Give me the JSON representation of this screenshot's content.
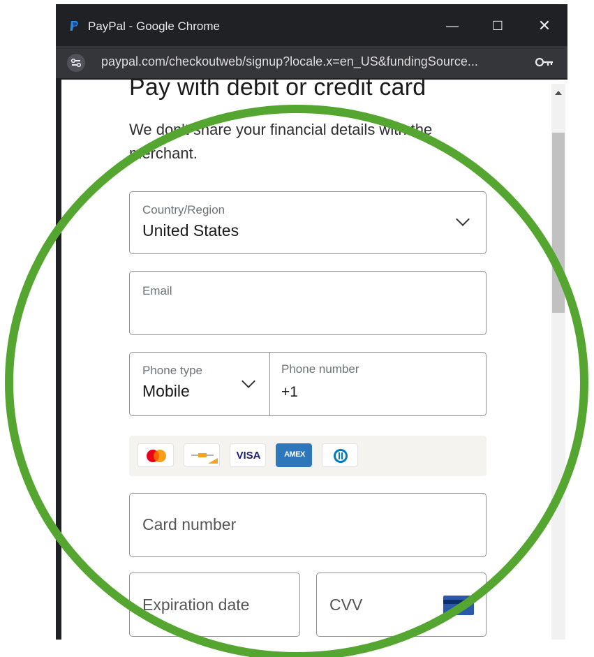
{
  "window": {
    "title": "PayPal - Google Chrome",
    "minimize_glyph": "—",
    "maximize_glyph": "☐",
    "close_glyph": "✕",
    "url": "paypal.com/checkoutweb/signup?locale.x=en_US&fundingSource..."
  },
  "page": {
    "heading": "Pay with debit or credit card",
    "subtitle": "We don't share your financial details with the merchant."
  },
  "form": {
    "country": {
      "label": "Country/Region",
      "value": "United States"
    },
    "email": {
      "label": "Email",
      "value": ""
    },
    "phone_type": {
      "label": "Phone type",
      "value": "Mobile"
    },
    "phone_number": {
      "label": "Phone number",
      "value": "+1"
    },
    "card_number": {
      "placeholder": "Card number"
    },
    "expiration": {
      "placeholder": "Expiration date"
    },
    "cvv": {
      "placeholder": "CVV"
    }
  },
  "card_brands": [
    {
      "icon": "mastercard-icon"
    },
    {
      "icon": "maestro-icon"
    },
    {
      "icon": "visa-icon",
      "text": "VISA"
    },
    {
      "icon": "amex-icon",
      "text": "AMEX"
    },
    {
      "icon": "diners-club-icon"
    }
  ],
  "colors": {
    "annotation_circle": "#55a630",
    "chrome_dark": "#202124",
    "amex_blue": "#2e77bb"
  }
}
